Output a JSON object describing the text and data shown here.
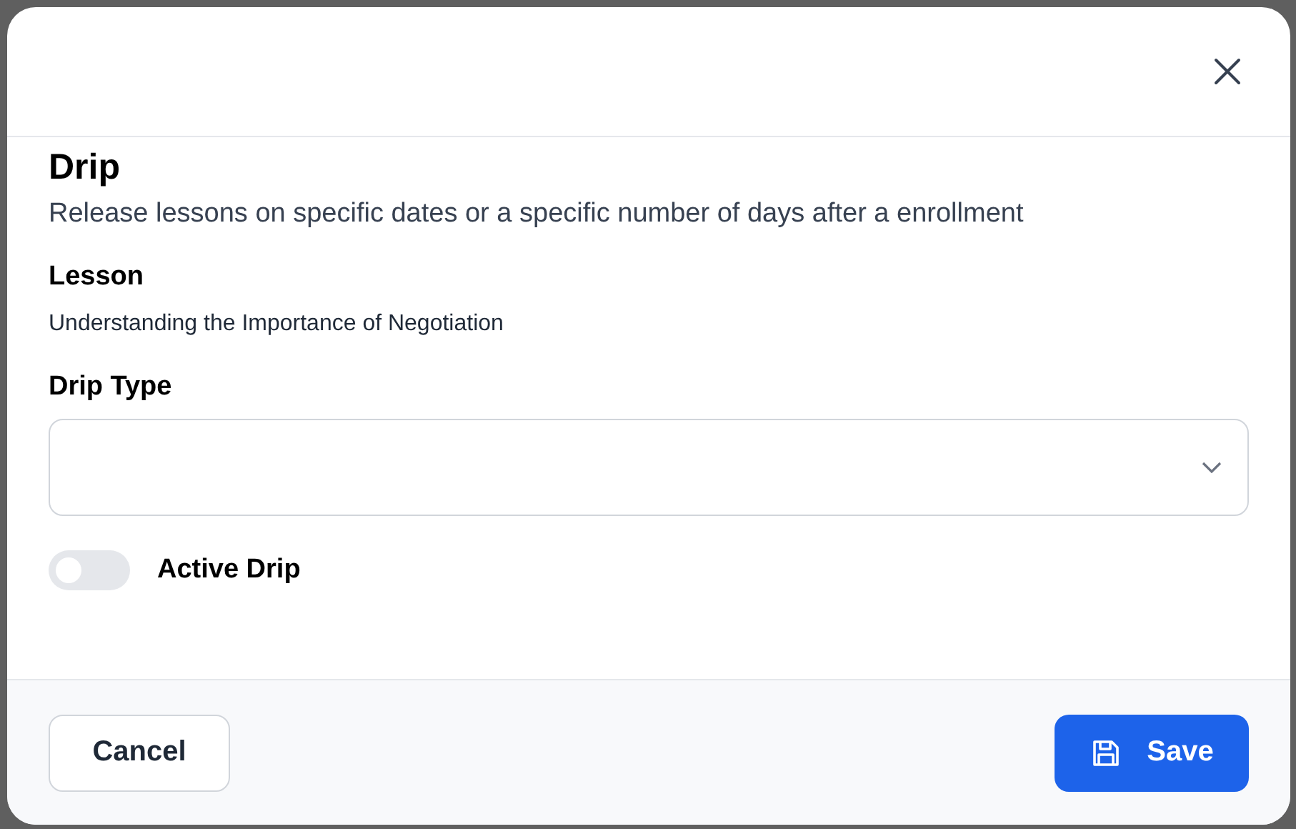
{
  "dialog": {
    "title": "Drip",
    "description": "Release lessons on specific dates or a specific number of days after a enrollment"
  },
  "fields": [
    {
      "kind": "text",
      "label": "Lesson",
      "value": "Understanding the Importance of Negotiation"
    },
    {
      "kind": "select",
      "label": "Drip Type"
    },
    {
      "kind": "toggle",
      "label": "Active Drip",
      "on": false
    }
  ],
  "buttons": [
    {
      "kind": "secondary",
      "label": "Cancel"
    },
    {
      "kind": "primary",
      "label": "Save"
    }
  ]
}
